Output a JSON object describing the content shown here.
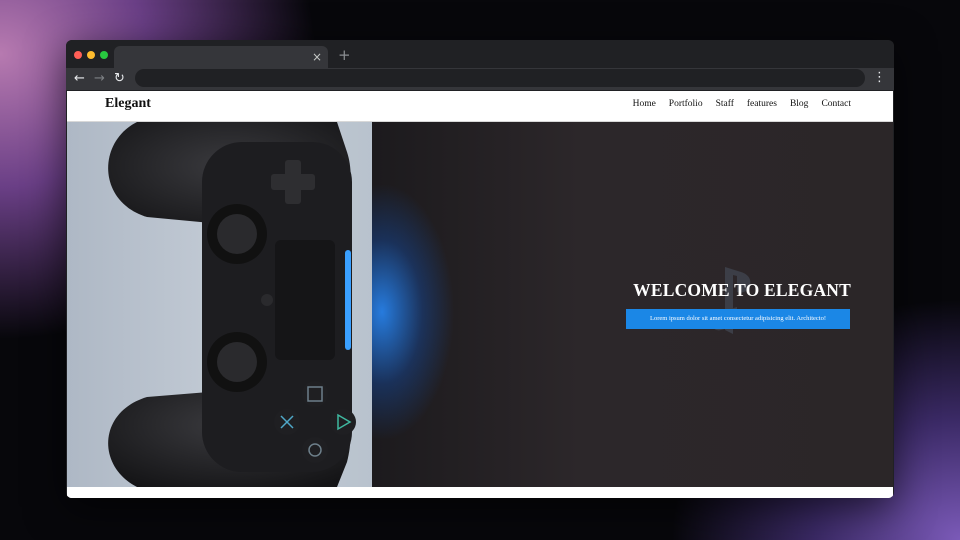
{
  "browser": {
    "tab": {
      "title": "",
      "close_glyph": "×"
    },
    "new_tab_glyph": "+",
    "toolbar": {
      "back_glyph": "←",
      "forward_glyph": "→",
      "reload_glyph": "↻",
      "menu_glyph": "⋮"
    },
    "address": {
      "value": ""
    },
    "window_controls": {
      "close_color": "#ff5f57",
      "minimize_color": "#febc2e",
      "zoom_color": "#28c840"
    }
  },
  "site": {
    "logo": "Elegant",
    "nav": [
      "Home",
      "Portfolio",
      "Staff",
      "features",
      "Blog",
      "Contact"
    ],
    "hero": {
      "title": "WELCOME TO ELEGANT",
      "button_label": "Lorem ipsum dolor sit amet consectetur adipisicing elit. Architecto!",
      "accent_color": "#1b87e6"
    }
  }
}
